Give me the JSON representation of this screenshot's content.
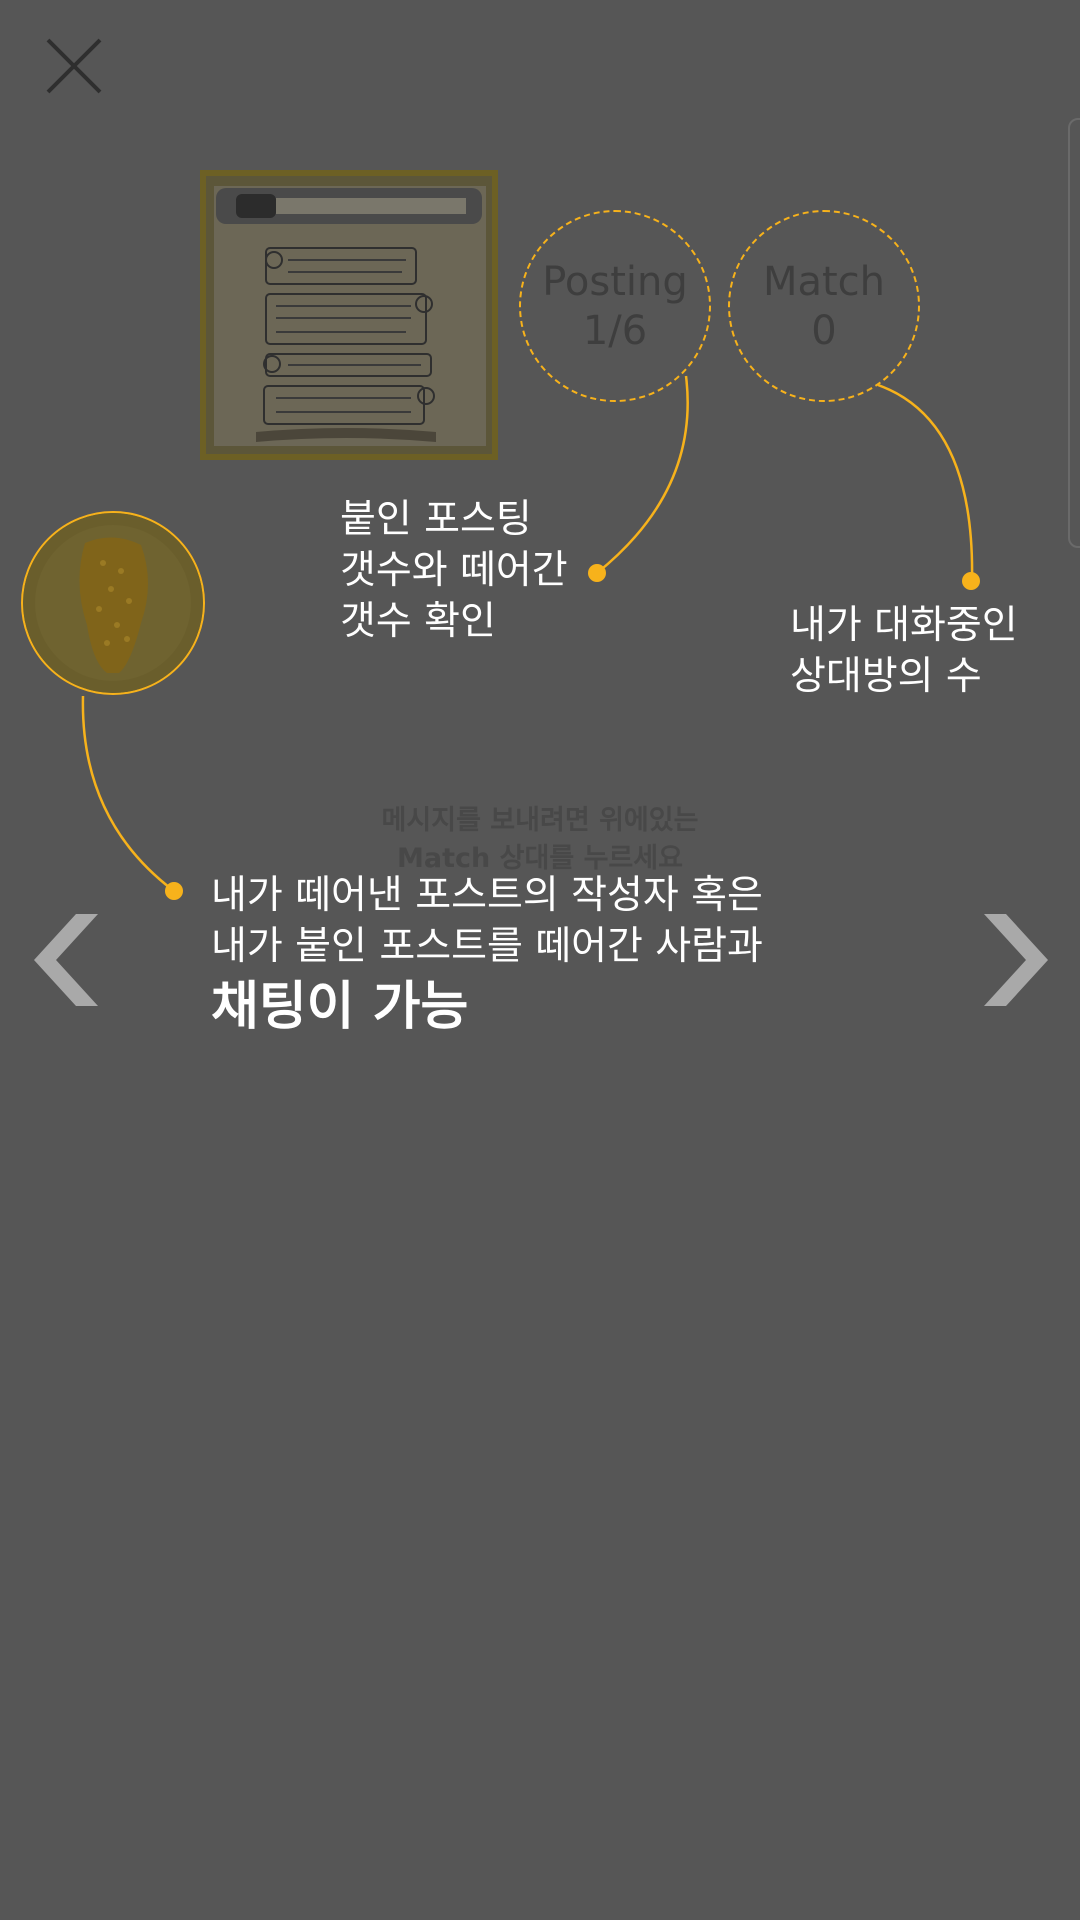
{
  "tutorial": {
    "posting": {
      "label": "Posting",
      "value": "1/6"
    },
    "match": {
      "label": "Match",
      "value": "0"
    },
    "notes": {
      "posting_line1": "붙인 포스팅",
      "posting_line2": "갯수와 떼어간",
      "posting_line3": "갯수 확인",
      "match_line1": "내가 대화중인",
      "match_line2": "상대방의 수",
      "chat_line1": "내가 떼어낸 포스트의 작성자 혹은",
      "chat_line2": "내가 붙인 포스트를 떼어간 사람과",
      "chat_emphasis": "채팅이 가능"
    },
    "hint_line1": "메시지를 보내려면 위에있는",
    "hint_line2": "Match 상대를 누르세요"
  },
  "icons": {
    "close": "close-icon",
    "prev": "chevron-left-icon",
    "next": "chevron-right-icon"
  },
  "colors": {
    "overlay": "#565656",
    "accent": "#f7b21b",
    "text": "#ffffff"
  }
}
